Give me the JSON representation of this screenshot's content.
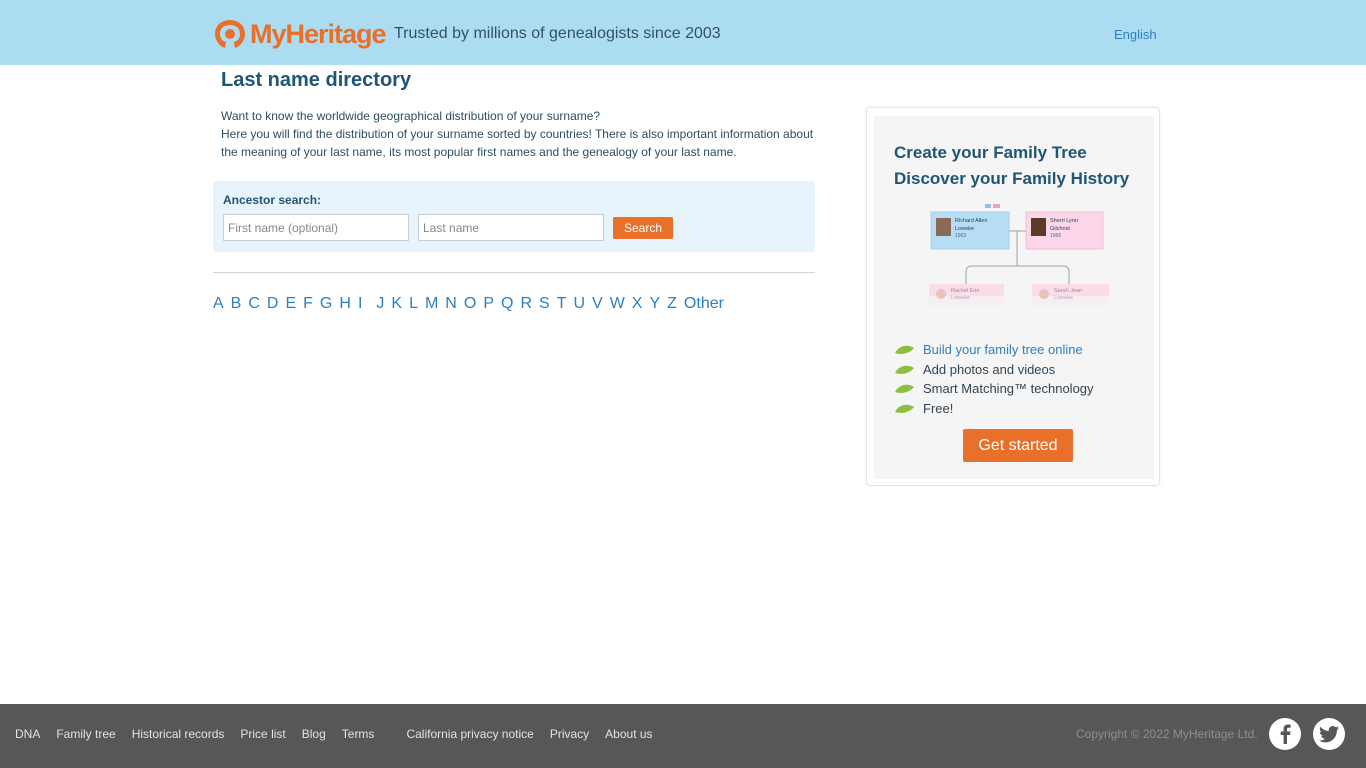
{
  "header": {
    "logo_text": "MyHeritage",
    "tagline": "Trusted by millions of genealogists since 2003",
    "language": "English"
  },
  "main": {
    "title": "Last name directory",
    "intro_line1": "Want to know the worldwide geographical distribution of your surname?",
    "intro_line2": "Here you will find the distribution of your surname sorted by countries! There is also important information about the meaning of your last name, its most popular first names and the genealogy of your last name."
  },
  "search": {
    "label": "Ancestor search:",
    "first_placeholder": "First name (optional)",
    "last_placeholder": "Last name",
    "button": "Search"
  },
  "letters": [
    "A",
    "B",
    "C",
    "D",
    "E",
    "F",
    "G",
    "H",
    "I",
    "J",
    "K",
    "L",
    "M",
    "N",
    "O",
    "P",
    "Q",
    "R",
    "S",
    "T",
    "U",
    "V",
    "W",
    "X",
    "Y",
    "Z",
    "Other"
  ],
  "promo": {
    "title_line1": "Create your Family Tree",
    "title_line2": "Discover your Family History",
    "tree": {
      "person1_name1": "Richard Allen",
      "person1_name2": "Loweke",
      "person1_year": "1963",
      "person2_name1": "Sherri Lynn",
      "person2_name2": "Gilchrist",
      "person2_year": "1966",
      "child1_name1": "Rachel Erin",
      "child1_name2": "Loweke",
      "child2_name1": "Sarah Jean",
      "child2_name2": "Loweke"
    },
    "features": [
      "Build your family tree online",
      "Add photos and videos",
      "Smart Matching™ technology",
      "Free!"
    ],
    "cta": "Get started"
  },
  "footer": {
    "links": [
      "DNA",
      "Family tree",
      "Historical records",
      "Price list",
      "Blog",
      "Terms",
      "California privacy notice",
      "Privacy",
      "About us"
    ],
    "copyright": "Copyright © 2022 MyHeritage Ltd.",
    "social": [
      "facebook-icon",
      "twitter-icon"
    ]
  },
  "colors": {
    "header_bg": "#acdcf1",
    "brand_orange": "#e8702a",
    "link_blue": "#2d7fc0",
    "title_blue": "#1f5577",
    "footer_bg": "#575757"
  }
}
